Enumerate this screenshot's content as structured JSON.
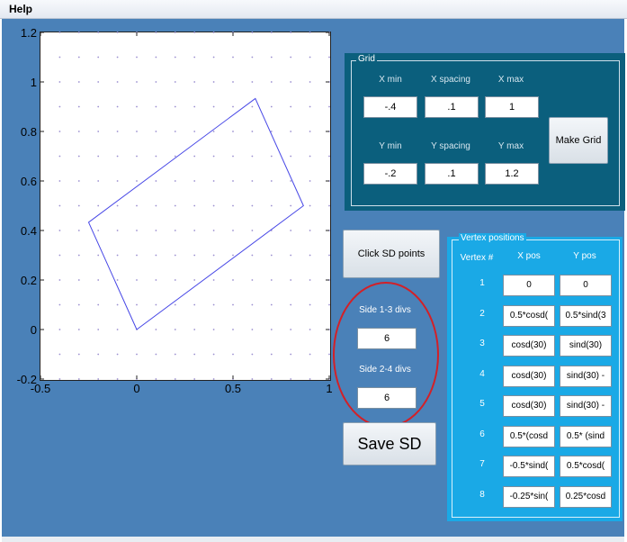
{
  "menubar": {
    "help_label": "Help"
  },
  "colors": {
    "figure_background": "#4a81b8",
    "grid_panel": "#0b5f7d",
    "vertex_panel": "#1aa9e6",
    "polygon_line": "#4747e6",
    "grid_dots": "#9b8fd0",
    "highlight_ellipse": "#d32027"
  },
  "chart_data": {
    "type": "line",
    "xlim": [
      -0.5,
      1
    ],
    "ylim": [
      -0.2,
      1.2
    ],
    "x_ticks": [
      "-0.5",
      "0",
      "0.5",
      "1"
    ],
    "y_ticks": [
      "-0.2",
      "0",
      "0.2",
      "0.4",
      "0.6",
      "0.8",
      "1",
      "1.2"
    ],
    "grid": "dots",
    "grid_dots": {
      "x_start": -0.4,
      "x_step": 0.1,
      "x_end": 1.0,
      "y_start": -0.2,
      "y_step": 0.1,
      "y_end": 1.2
    },
    "polygon": {
      "x": [
        0,
        0.866,
        0.616,
        -0.25,
        0
      ],
      "y": [
        0,
        0.5,
        0.933,
        0.433,
        0
      ]
    }
  },
  "grid_panel": {
    "title": "Grid",
    "xmin_label": "X min",
    "xspacing_label": "X spacing",
    "xmax_label": "X max",
    "xmin": "-.4",
    "xspacing": ".1",
    "xmax": "1",
    "ymin_label": "Y min",
    "yspacing_label": "Y spacing",
    "ymax_label": "Y max",
    "ymin": "-.2",
    "yspacing": ".1",
    "ymax": "1.2",
    "make_grid_label": "Make Grid"
  },
  "sd_controls": {
    "click_sd_label": "Click SD points",
    "side13_label": "Side 1-3 divs",
    "side13_value": "6",
    "side24_label": "Side 2-4 divs",
    "side24_value": "6",
    "save_sd_label": "Save SD"
  },
  "vertex_panel": {
    "title": "Vertex positions",
    "vertex_header": "Vertex #",
    "xpos_header": "X pos",
    "ypos_header": "Y pos",
    "rows": [
      {
        "n": "1",
        "x": "0",
        "y": "0"
      },
      {
        "n": "2",
        "x": "0.5*cosd(",
        "y": "0.5*sind(3"
      },
      {
        "n": "3",
        "x": "cosd(30)",
        "y": "sind(30)"
      },
      {
        "n": "4",
        "x": "cosd(30)",
        "y": "sind(30) -"
      },
      {
        "n": "5",
        "x": "cosd(30)",
        "y": "sind(30) -"
      },
      {
        "n": "6",
        "x": "0.5*(cosd",
        "y": "0.5* (sind"
      },
      {
        "n": "7",
        "x": "-0.5*sind(",
        "y": "0.5*cosd("
      },
      {
        "n": "8",
        "x": "-0.25*sin(",
        "y": "0.25*cosd"
      }
    ]
  }
}
